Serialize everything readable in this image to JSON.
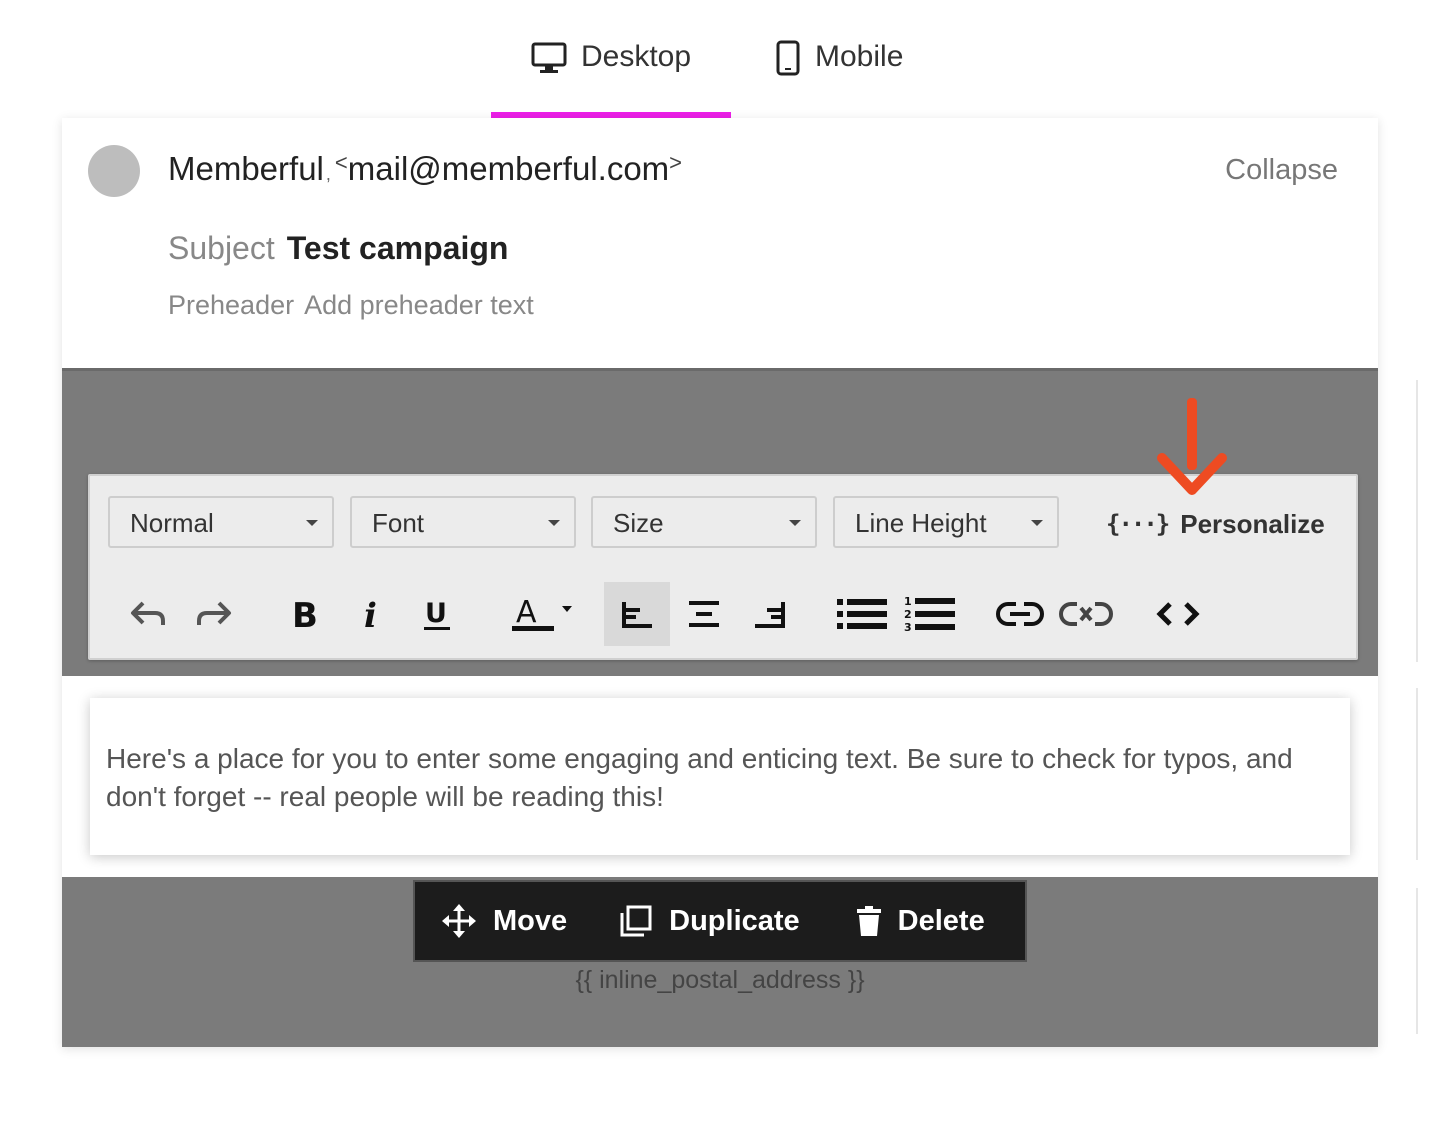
{
  "tabs": {
    "desktop": "Desktop",
    "mobile": "Mobile",
    "active": "Desktop",
    "active_color": "#ec1ee8"
  },
  "header": {
    "sender_name": "Memberful",
    "sender_email": "mail@memberful.com",
    "collapse": "Collapse",
    "subject_label": "Subject",
    "subject_value": "Test campaign",
    "preheader_label": "Preheader",
    "preheader_value": "Add preheader text"
  },
  "toolbar": {
    "dropdowns": {
      "format": "Normal",
      "font": "Font",
      "size": "Size",
      "line_height": "Line Height"
    },
    "personalize_icon": "{···}",
    "personalize": "Personalize",
    "buttons": [
      "undo-icon",
      "redo-icon",
      "bold-icon",
      "italic-icon",
      "underline-icon",
      "text-color-icon",
      "align-left-icon",
      "align-center-icon",
      "align-right-icon",
      "bullet-list-icon",
      "numbered-list-icon",
      "link-icon",
      "unlink-icon",
      "code-view-icon"
    ],
    "active_button": "align-left-icon",
    "annotation_color": "#ee4b22"
  },
  "content": {
    "body_text": "Here's a place for you to enter some engaging and enticing text. Be sure to check for typos, and don't forget -- real people will be reading this!"
  },
  "block_actions": {
    "move": "Move",
    "duplicate": "Duplicate",
    "delete": "Delete"
  },
  "footer": {
    "postal_address": "{{ inline_postal_address }}"
  }
}
